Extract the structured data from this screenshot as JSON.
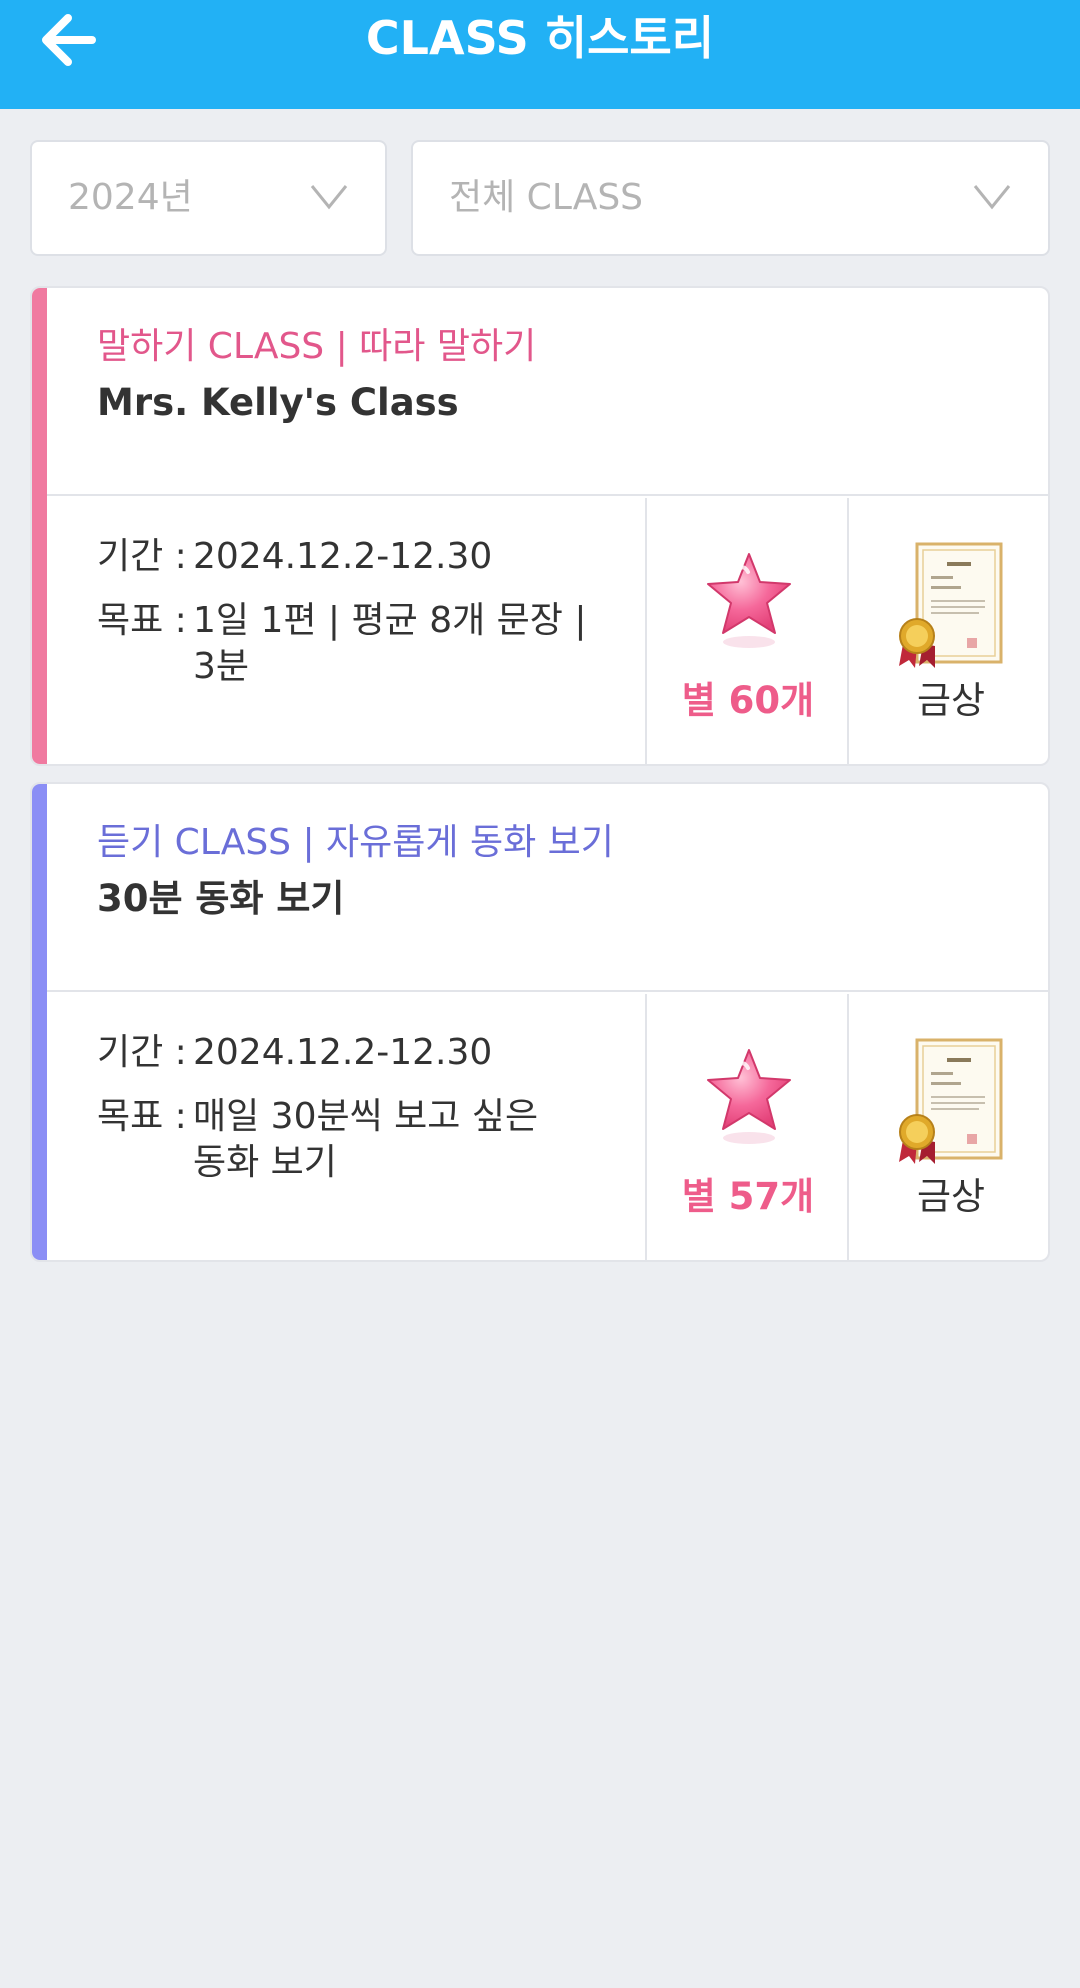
{
  "header": {
    "title": "CLASS 히스토리"
  },
  "filters": {
    "year": "2024년",
    "class": "전체 CLASS"
  },
  "colors": {
    "header": "#22b1f5",
    "speaking_accent": "#f07aa0",
    "listening_accent": "#8b8ef5",
    "star": "#ee5c8a"
  },
  "cards": [
    {
      "category": "말하기 CLASS | 따라 말하기",
      "category_color": "#e2578b",
      "name": "Mrs. Kelly's Class",
      "period_label": "기간 :",
      "period": "2024.12.2-12.30",
      "goal_label": "목표 :",
      "goal_line1": "1일 1편 | 평균 8개 문장 |",
      "goal_line2": "3분",
      "stars": "별 60개",
      "award": "금상",
      "icons": [
        "star-icon",
        "certificate-icon"
      ]
    },
    {
      "category": "듣기 CLASS | 자유롭게 동화 보기",
      "category_color": "#6a6ed8",
      "name": "30분 동화 보기",
      "period_label": "기간 :",
      "period": "2024.12.2-12.30",
      "goal_label": "목표 :",
      "goal_line1": "매일 30분씩 보고 싶은",
      "goal_line2": "동화 보기",
      "stars": "별 57개",
      "award": "금상",
      "icons": [
        "star-icon",
        "certificate-icon"
      ]
    }
  ]
}
